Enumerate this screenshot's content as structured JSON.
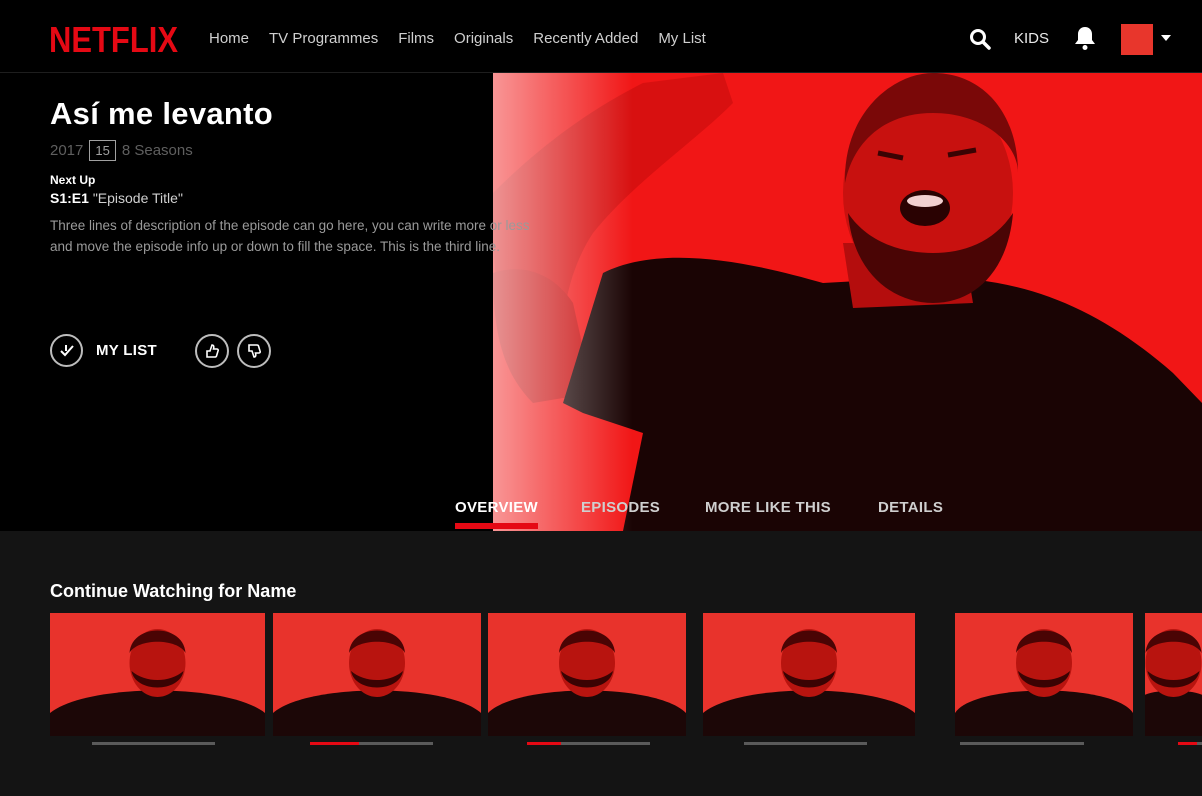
{
  "brand": {
    "logo_text": "NETFLIX",
    "accent": "#e50914"
  },
  "nav": {
    "links": [
      "Home",
      "TV Programmes",
      "Films",
      "Originals",
      "Recently Added",
      "My List"
    ],
    "kids_label": "KIDS",
    "icons": {
      "search": "search-icon",
      "notifications": "bell-icon",
      "menu": "caret-down-icon"
    }
  },
  "hero": {
    "title": "Así me levanto",
    "year": "2017",
    "rating": "15",
    "seasons": "8 Seasons",
    "next_up_label": "Next Up",
    "episode_code": "S1:E1",
    "episode_title": "\"Episode Title\"",
    "description": "Three lines of description of the episode can go here, you can write more or less and move the episode info up or down to fill the space. This is the third line.",
    "my_list_label": "MY LIST"
  },
  "tabs": [
    {
      "label": "OVERVIEW",
      "active": true
    },
    {
      "label": "EPISODES",
      "active": false
    },
    {
      "label": "MORE LIKE THIS",
      "active": false
    },
    {
      "label": "DETAILS",
      "active": false
    }
  ],
  "row": {
    "title": "Continue Watching for Name",
    "items": [
      {
        "progress": 0.0
      },
      {
        "progress": 0.4
      },
      {
        "progress": 0.28
      },
      {
        "progress": 0.0
      },
      {
        "progress": 0.0
      },
      {
        "progress": 0.8
      }
    ]
  }
}
